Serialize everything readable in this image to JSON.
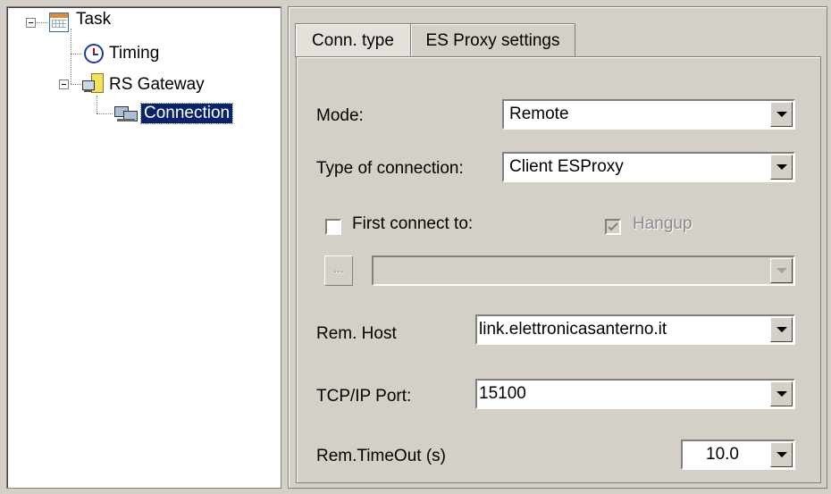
{
  "tree": {
    "items": [
      {
        "label": "Task"
      },
      {
        "label": "Timing"
      },
      {
        "label": "RS Gateway"
      },
      {
        "label": "Connection"
      }
    ]
  },
  "tabs": [
    {
      "label": "Conn. type"
    },
    {
      "label": "ES Proxy settings"
    }
  ],
  "form": {
    "mode_label": "Mode:",
    "mode_value": "Remote",
    "conn_type_label": "Type of connection:",
    "conn_type_value": "Client ESProxy",
    "first_connect_label": "First connect to:",
    "first_connect_checked": false,
    "hangup_label": "Hangup",
    "hangup_checked": true,
    "browse_label": "...",
    "first_connect_value": "",
    "rem_host_label": "Rem. Host",
    "rem_host_value": "link.elettronicasanterno.it",
    "port_label": "TCP/IP Port:",
    "port_value": "15100",
    "timeout_label": "Rem.TimeOut (s)",
    "timeout_value": "10.0"
  }
}
